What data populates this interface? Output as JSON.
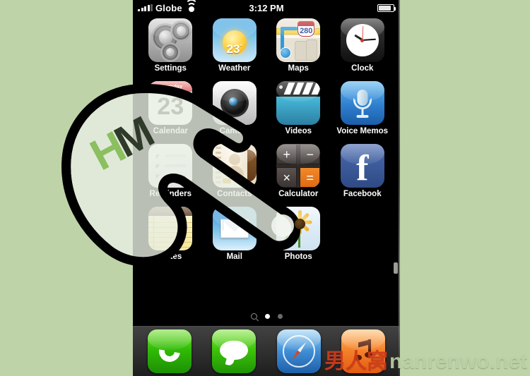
{
  "background_color": "#bed3a8",
  "status_bar": {
    "carrier": "Globe",
    "time": "3:12 PM",
    "signal_icon": "signal-bars-icon",
    "wifi_icon": "wifi-icon",
    "battery_icon": "battery-icon"
  },
  "home_screen": {
    "apps": [
      {
        "label": "Settings",
        "icon": "settings-icon"
      },
      {
        "label": "Weather",
        "icon": "weather-icon",
        "temperature": "23",
        "degree": "°"
      },
      {
        "label": "Maps",
        "icon": "maps-icon",
        "route_number": "280"
      },
      {
        "label": "Clock",
        "icon": "clock-icon"
      },
      {
        "label": "Calendar",
        "icon": "calendar-icon",
        "weekday": "Thursday",
        "day": "23"
      },
      {
        "label": "Camera",
        "icon": "camera-icon"
      },
      {
        "label": "Videos",
        "icon": "videos-icon"
      },
      {
        "label": "Voice Memos",
        "icon": "voice-memos-icon"
      },
      {
        "label": "Reminders",
        "icon": "reminders-icon"
      },
      {
        "label": "Contacts",
        "icon": "contacts-icon"
      },
      {
        "label": "Calculator",
        "icon": "calculator-icon",
        "keys": [
          "+",
          "−",
          "×",
          "="
        ]
      },
      {
        "label": "Facebook",
        "icon": "facebook-icon",
        "glyph": "f"
      },
      {
        "label": "Notes",
        "icon": "notes-icon"
      },
      {
        "label": "Mail",
        "icon": "mail-icon"
      },
      {
        "label": "Photos",
        "icon": "photos-icon"
      }
    ]
  },
  "page_indicator": {
    "search_icon": "search-icon",
    "pages": 2,
    "active_page": 1
  },
  "dock": {
    "apps": [
      {
        "label": "Phone",
        "icon": "phone-icon"
      },
      {
        "label": "Messages",
        "icon": "messages-icon"
      },
      {
        "label": "Safari",
        "icon": "safari-icon"
      },
      {
        "label": "iPod",
        "icon": "ipod-icon"
      }
    ]
  },
  "overlay": {
    "pointer_icon": "pointing-hand-cursor",
    "watermark_letters": {
      "first": "H",
      "second": "M"
    },
    "watermark_bottom": {
      "cjk": "男人窝",
      "latin": "nanrenwo.net"
    }
  }
}
